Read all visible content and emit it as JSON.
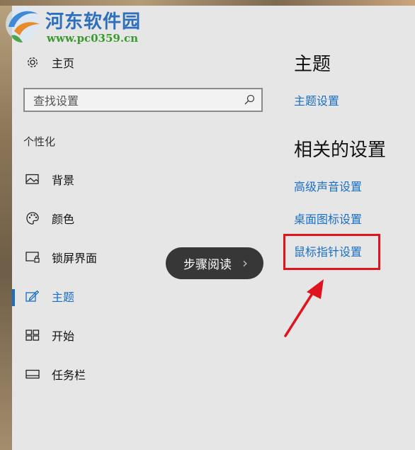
{
  "watermark": {
    "title": "河东软件园",
    "url": "www.pc0359.cn"
  },
  "sidebar": {
    "home_label": "主页",
    "search_placeholder": "查找设置",
    "section_label": "个性化",
    "items": [
      {
        "label": "背景",
        "icon": "image-icon"
      },
      {
        "label": "颜色",
        "icon": "palette-icon"
      },
      {
        "label": "锁屏界面",
        "icon": "lock-screen-icon"
      },
      {
        "label": "主题",
        "icon": "theme-icon",
        "active": true
      },
      {
        "label": "开始",
        "icon": "start-icon"
      },
      {
        "label": "任务栏",
        "icon": "taskbar-icon"
      }
    ]
  },
  "content": {
    "title": "主题",
    "theme_settings_link": "主题设置",
    "related_title": "相关的设置",
    "links": [
      "高级声音设置",
      "桌面图标设置",
      "鼠标指针设置"
    ]
  },
  "overlay": {
    "step_reading": "步骤阅读",
    "chevron": "›"
  },
  "colors": {
    "accent": "#1a6fc4",
    "highlight": "#e0141e",
    "background": "#e6e6e6"
  }
}
